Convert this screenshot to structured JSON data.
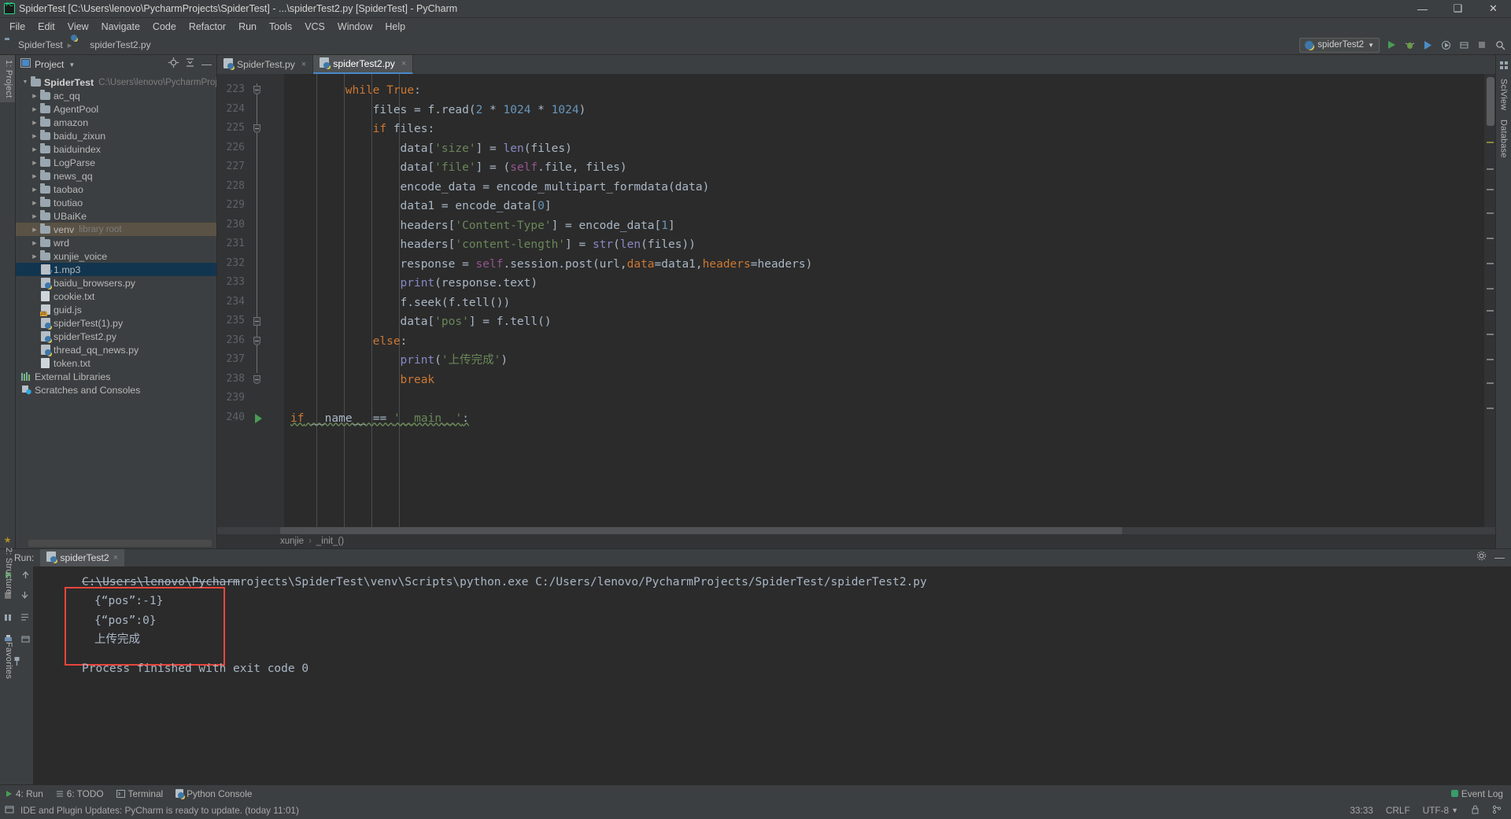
{
  "window": {
    "title": "SpiderTest [C:\\Users\\lenovo\\PycharmProjects\\SpiderTest] - ...\\spiderTest2.py [SpiderTest] - PyCharm",
    "app_logo": "pycharm-logo-icon",
    "minimize": "—",
    "maximize": "❑",
    "close": "✕"
  },
  "menu": {
    "items": [
      "File",
      "Edit",
      "View",
      "Navigate",
      "Code",
      "Refactor",
      "Run",
      "Tools",
      "VCS",
      "Window",
      "Help"
    ]
  },
  "navbar": {
    "crumbs": [
      "SpiderTest",
      "spiderTest2.py"
    ],
    "run_config": "spiderTest2",
    "icons": [
      "run-icon",
      "debug-icon",
      "coverage-icon",
      "profile-icon",
      "attach-icon",
      "stop-icon",
      "search-icon"
    ]
  },
  "left_rail": {
    "project_tab": "1: Project",
    "structure_tab": "2: Structure",
    "favorites_tab": "Favorites"
  },
  "right_rail": {
    "sciview_tab": "SciView",
    "database_tab": "Database"
  },
  "project": {
    "header_title": "Project",
    "root": {
      "label": "SpiderTest",
      "path": "C:\\Users\\lenovo\\PycharmProjects\\Spid"
    },
    "items": [
      {
        "label": "ac_qq",
        "type": "folder",
        "expandable": true,
        "indent": 1,
        "state": "none"
      },
      {
        "label": "AgentPool",
        "type": "folder",
        "expandable": true,
        "indent": 1,
        "state": "none"
      },
      {
        "label": "amazon",
        "type": "folder",
        "expandable": true,
        "indent": 1,
        "state": "none"
      },
      {
        "label": "baidu_zixun",
        "type": "folder",
        "expandable": true,
        "indent": 1,
        "state": "none"
      },
      {
        "label": "baiduindex",
        "type": "folder",
        "expandable": true,
        "indent": 1,
        "state": "none"
      },
      {
        "label": "LogParse",
        "type": "folder",
        "expandable": true,
        "indent": 1,
        "state": "none"
      },
      {
        "label": "news_qq",
        "type": "folder",
        "expandable": true,
        "indent": 1,
        "state": "none"
      },
      {
        "label": "taobao",
        "type": "folder",
        "expandable": true,
        "indent": 1,
        "state": "none"
      },
      {
        "label": "toutiao",
        "type": "folder",
        "expandable": true,
        "indent": 1,
        "state": "none"
      },
      {
        "label": "UBaiKe",
        "type": "folder",
        "expandable": true,
        "indent": 1,
        "state": "none"
      },
      {
        "label": "venv",
        "type": "folder",
        "expandable": true,
        "indent": 1,
        "state": "olive",
        "suffix": "library root"
      },
      {
        "label": "wrd",
        "type": "folder",
        "expandable": true,
        "indent": 1,
        "state": "none"
      },
      {
        "label": "xunjie_voice",
        "type": "folder",
        "expandable": true,
        "indent": 1,
        "state": "none"
      },
      {
        "label": "1.mp3",
        "type": "mp3",
        "expandable": false,
        "indent": 1,
        "state": "blue"
      },
      {
        "label": "baidu_browsers.py",
        "type": "py",
        "expandable": false,
        "indent": 1,
        "state": "none"
      },
      {
        "label": "cookie.txt",
        "type": "txt",
        "expandable": false,
        "indent": 1,
        "state": "none"
      },
      {
        "label": "guid.js",
        "type": "js",
        "expandable": false,
        "indent": 1,
        "state": "none"
      },
      {
        "label": "spiderTest(1).py",
        "type": "py",
        "expandable": false,
        "indent": 1,
        "state": "none"
      },
      {
        "label": "spiderTest2.py",
        "type": "py",
        "expandable": false,
        "indent": 1,
        "state": "none"
      },
      {
        "label": "thread_qq_news.py",
        "type": "py",
        "expandable": false,
        "indent": 1,
        "state": "none"
      },
      {
        "label": "token.txt",
        "type": "txt",
        "expandable": false,
        "indent": 1,
        "state": "none"
      },
      {
        "label": "External Libraries",
        "type": "libs",
        "expandable": false,
        "indent": 0,
        "state": "none"
      },
      {
        "label": "Scratches and Consoles",
        "type": "scratch",
        "expandable": false,
        "indent": 0,
        "state": "none"
      }
    ]
  },
  "editor": {
    "tabs": [
      {
        "label": "SpiderTest.py",
        "active": false,
        "close": "×"
      },
      {
        "label": "spiderTest2.py",
        "active": true,
        "close": "×"
      }
    ],
    "first_line_number": 223,
    "lines": [
      {
        "n": 223,
        "indent": 8,
        "fold": "cap",
        "tokens": [
          {
            "t": "while",
            "c": "kw"
          },
          {
            "t": " True",
            "c": "kw"
          },
          {
            "t": ":",
            "c": "plain"
          }
        ]
      },
      {
        "n": 224,
        "indent": 12,
        "fold": "",
        "tokens": [
          {
            "t": "files = f.read(",
            "c": "plain"
          },
          {
            "t": "2",
            "c": "num"
          },
          {
            "t": " * ",
            "c": "plain"
          },
          {
            "t": "1024",
            "c": "num"
          },
          {
            "t": " * ",
            "c": "plain"
          },
          {
            "t": "1024",
            "c": "num"
          },
          {
            "t": ")",
            "c": "plain"
          }
        ]
      },
      {
        "n": 225,
        "indent": 12,
        "fold": "cap",
        "tokens": [
          {
            "t": "if",
            "c": "kw"
          },
          {
            "t": " files:",
            "c": "plain"
          }
        ]
      },
      {
        "n": 226,
        "indent": 16,
        "fold": "",
        "tokens": [
          {
            "t": "data[",
            "c": "plain"
          },
          {
            "t": "'size'",
            "c": "str"
          },
          {
            "t": "] = ",
            "c": "plain"
          },
          {
            "t": "len",
            "c": "fn"
          },
          {
            "t": "(files)",
            "c": "plain"
          }
        ]
      },
      {
        "n": 227,
        "indent": 16,
        "fold": "",
        "tokens": [
          {
            "t": "data[",
            "c": "plain"
          },
          {
            "t": "'file'",
            "c": "str"
          },
          {
            "t": "] = (",
            "c": "plain"
          },
          {
            "t": "self",
            "c": "self"
          },
          {
            "t": ".file, files)",
            "c": "plain"
          }
        ]
      },
      {
        "n": 228,
        "indent": 16,
        "fold": "",
        "tokens": [
          {
            "t": "encode_data = encode_multipart_formdata(data)",
            "c": "plain"
          }
        ]
      },
      {
        "n": 229,
        "indent": 16,
        "fold": "",
        "tokens": [
          {
            "t": "data1 = encode_data[",
            "c": "plain"
          },
          {
            "t": "0",
            "c": "num"
          },
          {
            "t": "]",
            "c": "plain"
          }
        ]
      },
      {
        "n": 230,
        "indent": 16,
        "fold": "",
        "tokens": [
          {
            "t": "headers[",
            "c": "plain"
          },
          {
            "t": "'Content-Type'",
            "c": "str"
          },
          {
            "t": "] = encode_data[",
            "c": "plain"
          },
          {
            "t": "1",
            "c": "num"
          },
          {
            "t": "]",
            "c": "plain"
          }
        ]
      },
      {
        "n": 231,
        "indent": 16,
        "fold": "",
        "tokens": [
          {
            "t": "headers[",
            "c": "plain"
          },
          {
            "t": "'content-length'",
            "c": "str"
          },
          {
            "t": "] = ",
            "c": "plain"
          },
          {
            "t": "str",
            "c": "fn"
          },
          {
            "t": "(",
            "c": "plain"
          },
          {
            "t": "len",
            "c": "fn"
          },
          {
            "t": "(files))",
            "c": "plain"
          }
        ]
      },
      {
        "n": 232,
        "indent": 16,
        "fold": "",
        "tokens": [
          {
            "t": "response = ",
            "c": "plain"
          },
          {
            "t": "self",
            "c": "self"
          },
          {
            "t": ".session.post(url,",
            "c": "plain"
          },
          {
            "t": "data",
            "c": "param"
          },
          {
            "t": "=data1,",
            "c": "plain"
          },
          {
            "t": "headers",
            "c": "param"
          },
          {
            "t": "=headers)",
            "c": "plain"
          }
        ]
      },
      {
        "n": 233,
        "indent": 16,
        "fold": "",
        "tokens": [
          {
            "t": "print",
            "c": "fn"
          },
          {
            "t": "(response.text)",
            "c": "plain"
          }
        ]
      },
      {
        "n": 234,
        "indent": 16,
        "fold": "",
        "tokens": [
          {
            "t": "f.seek(f.tell())",
            "c": "plain"
          }
        ]
      },
      {
        "n": 235,
        "indent": 16,
        "fold": "mid",
        "tokens": [
          {
            "t": "data[",
            "c": "plain"
          },
          {
            "t": "'pos'",
            "c": "str"
          },
          {
            "t": "] = f.tell()",
            "c": "plain"
          }
        ]
      },
      {
        "n": 236,
        "indent": 12,
        "fold": "cap",
        "tokens": [
          {
            "t": "else",
            "c": "kw"
          },
          {
            "t": ":",
            "c": "plain"
          }
        ]
      },
      {
        "n": 237,
        "indent": 16,
        "fold": "",
        "tokens": [
          {
            "t": "print",
            "c": "fn"
          },
          {
            "t": "(",
            "c": "plain"
          },
          {
            "t": "'上传完成'",
            "c": "str"
          },
          {
            "t": ")",
            "c": "plain"
          }
        ]
      },
      {
        "n": 238,
        "indent": 16,
        "fold": "cap",
        "tokens": [
          {
            "t": "break",
            "c": "kw"
          }
        ]
      },
      {
        "n": 239,
        "indent": 0,
        "fold": "",
        "tokens": []
      },
      {
        "n": 240,
        "indent": 0,
        "fold": "",
        "run_marker": true,
        "tokens": [
          {
            "t": "if",
            "c": "kw"
          },
          {
            "t": " __name__ == ",
            "c": "plain"
          },
          {
            "t": "'__main__'",
            "c": "str"
          },
          {
            "t": ":",
            "c": "plain"
          }
        ]
      }
    ],
    "breadcrumbs": [
      "xunjie",
      "_init_()"
    ]
  },
  "run_tool_window": {
    "label": "Run:",
    "tab": "spiderTest2",
    "tab_close": "×",
    "toolbar_icons": [
      "rerun-icon",
      "scroll-up-icon",
      "scroll-down-icon",
      "stop-icon",
      "pause-icon",
      "print-icon",
      "soft-wrap-icon",
      "pin-icon",
      "clear-icon"
    ],
    "header_icons": [
      "settings-gear-icon",
      "minimize-icon"
    ],
    "console_lines": [
      {
        "text": "C:\\Users\\lenovo\\PycharmProjects\\SpiderTest\\venv\\Scripts\\python.exe C:/Users/lenovo/PycharmProjects/SpiderTest/spiderTest2.py",
        "style": "cmd"
      },
      {
        "text": "{“pos”:-1}",
        "style": "out"
      },
      {
        "text": "{“pos”:0}",
        "style": "out"
      },
      {
        "text": "上传完成",
        "style": "out"
      },
      {
        "text": "Process finished with exit code 0",
        "style": "out"
      }
    ],
    "annotation": {
      "name": "red-highlight-box",
      "color": "#e8453c"
    }
  },
  "status_bar": {
    "tabs": [
      {
        "label": "4: Run",
        "icon": "run-icon"
      },
      {
        "label": "6: TODO",
        "icon": "todo-icon"
      },
      {
        "label": "Terminal",
        "icon": "terminal-icon"
      },
      {
        "label": "Python Console",
        "icon": "python-icon"
      }
    ],
    "event_log": "Event Log",
    "message": "IDE and Plugin Updates: PyCharm is ready to update. (today 11:01)",
    "caret_position": "33:33",
    "line_separator": "CRLF",
    "encoding": "UTF-8",
    "encoding_caret": "‹",
    "lock_icon": "lock-icon",
    "branch_icon": "branch-icon"
  },
  "colors": {
    "accent_blue": "#4a88c7",
    "selection_blue": "#12354f",
    "selection_olive": "#5a5244",
    "editor_bg": "#2b2b2b",
    "panel_bg": "#3c3f41",
    "keyword_orange": "#cc7832",
    "string_green": "#6a8759",
    "number_blue": "#6897bb",
    "function_purple": "#8888c6",
    "self_magenta": "#94558d",
    "red_box": "#e8453c",
    "green_run": "#499c54"
  }
}
